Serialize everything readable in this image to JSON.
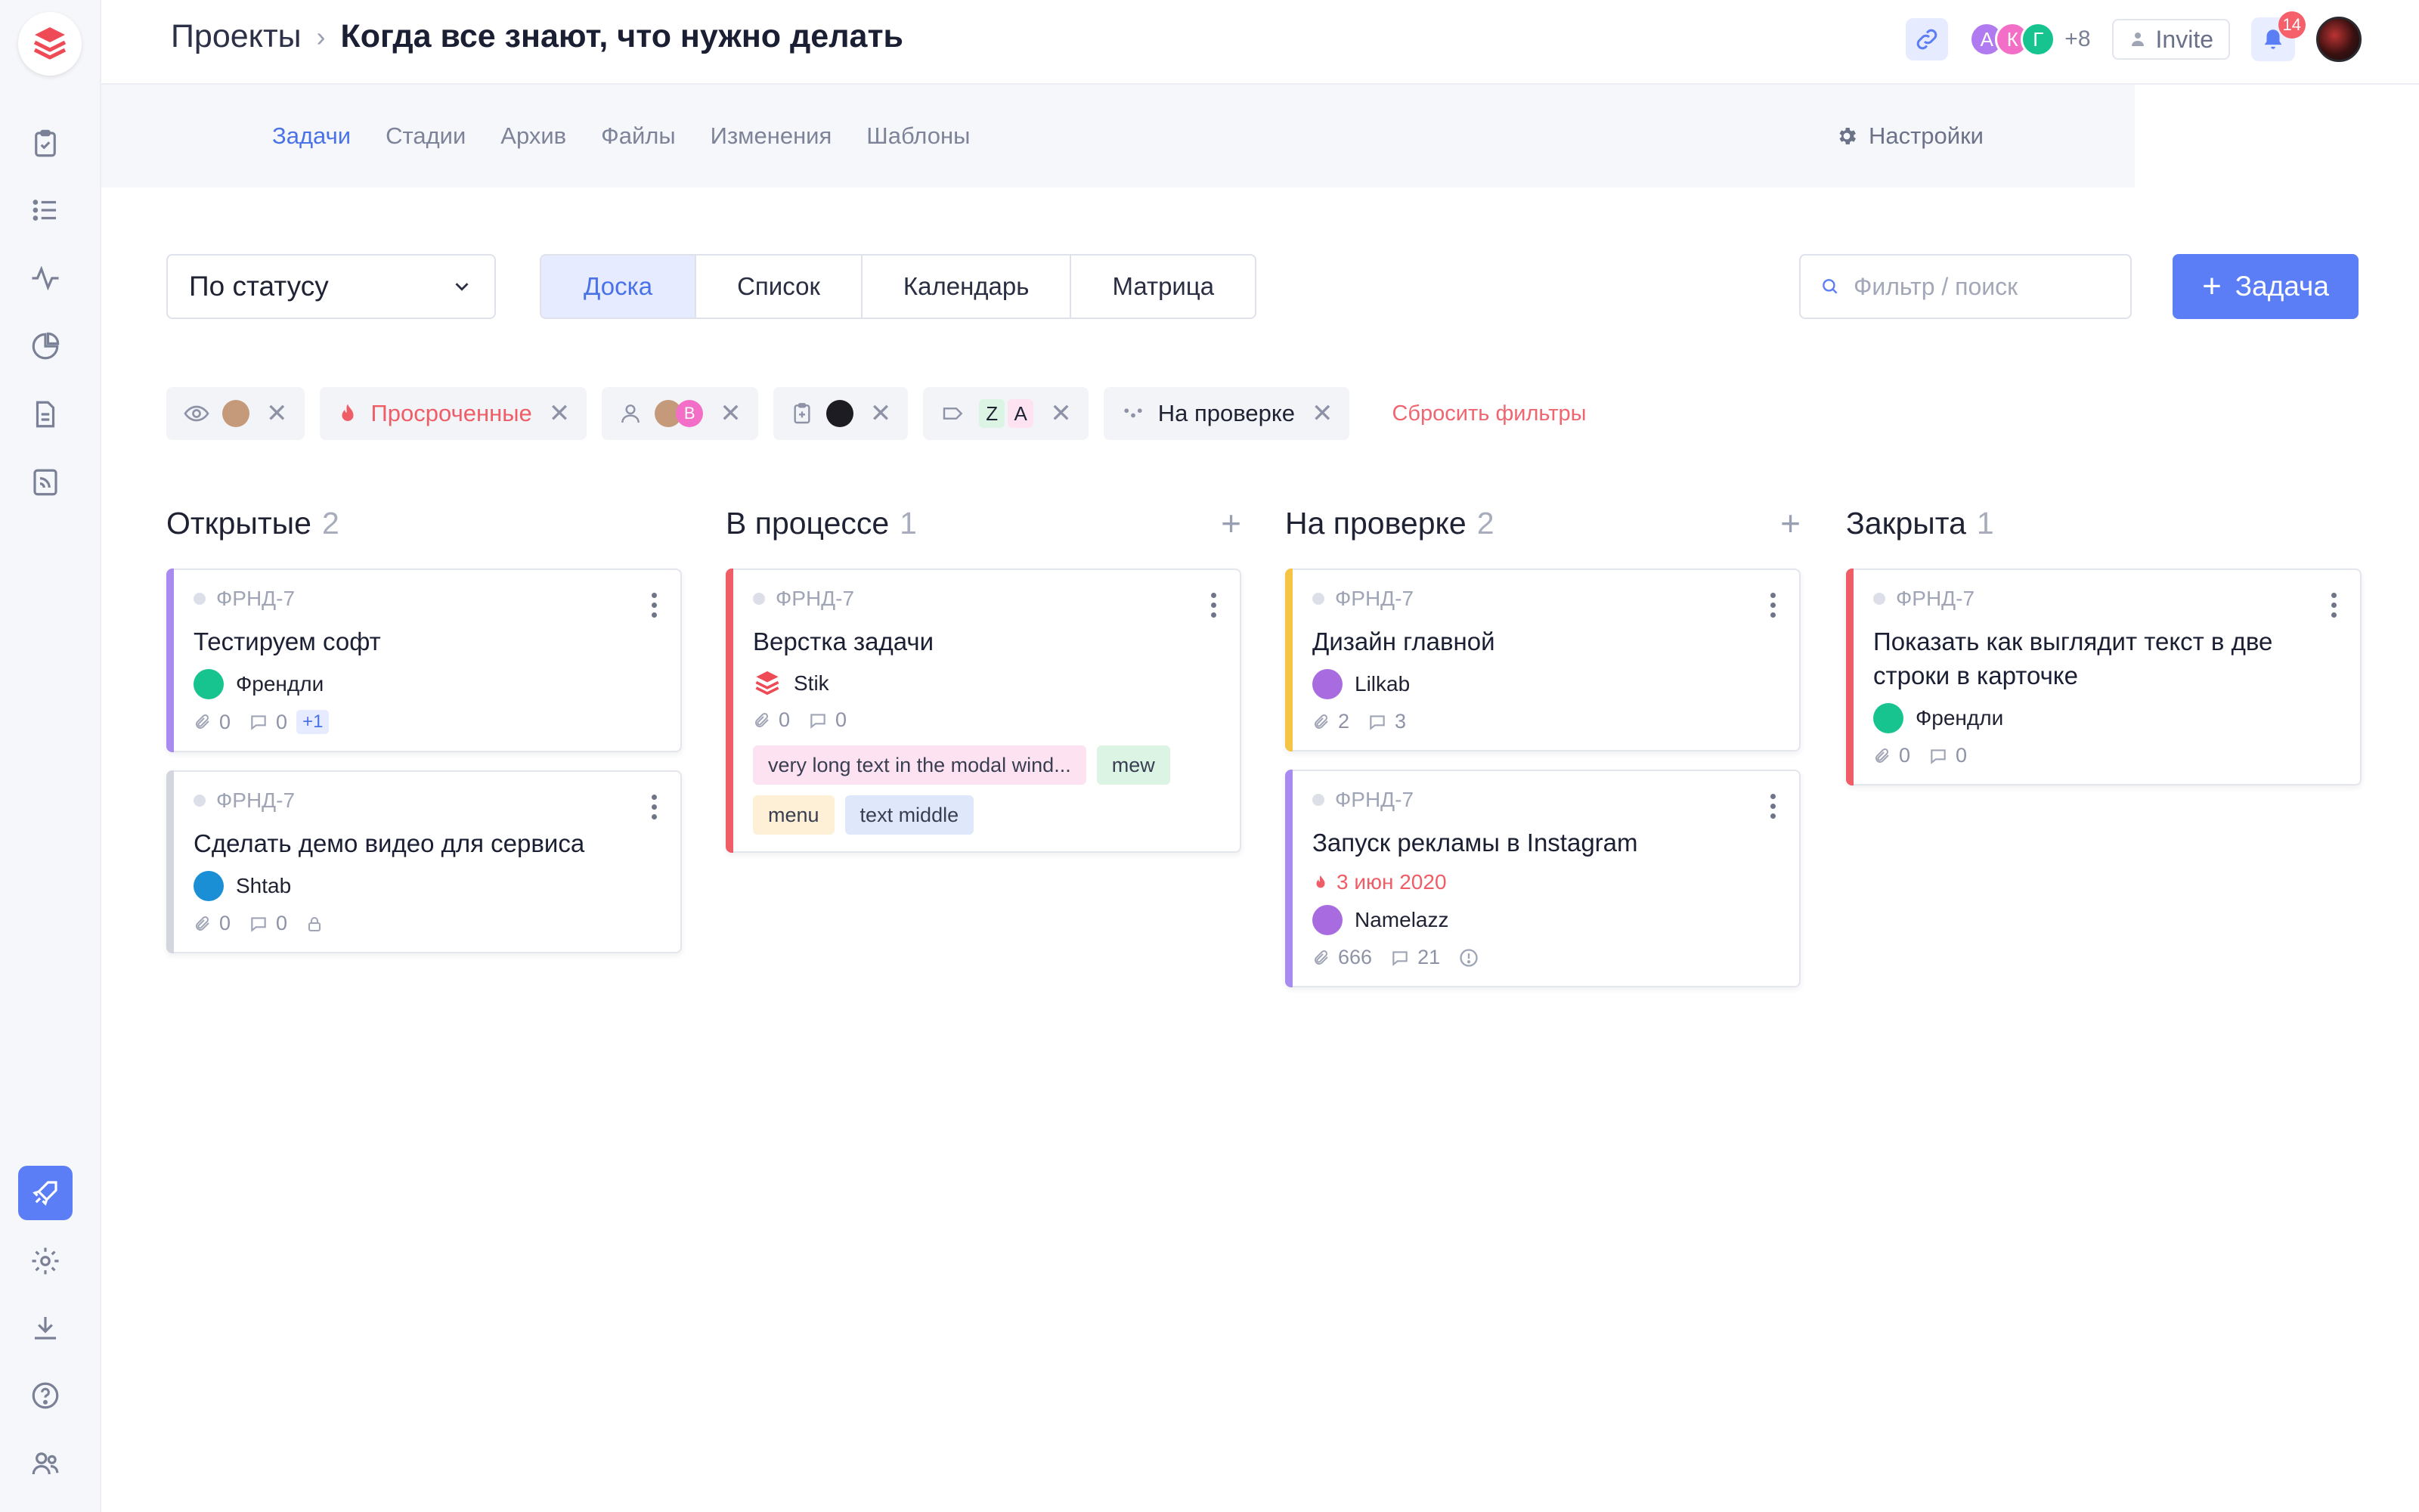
{
  "header": {
    "breadcrumb_root": "Проекты",
    "title": "Когда все знают, что нужно делать",
    "members": [
      {
        "initial": "А",
        "color": "#b07af0"
      },
      {
        "initial": "К",
        "color": "#f36fc7"
      },
      {
        "initial": "Г",
        "color": "#17c48f"
      }
    ],
    "members_more": "+8",
    "invite_label": "Invite",
    "notifications_count": "14"
  },
  "tabs": [
    {
      "label": "Задачи",
      "active": true
    },
    {
      "label": "Стадии"
    },
    {
      "label": "Архив"
    },
    {
      "label": "Файлы"
    },
    {
      "label": "Изменения"
    },
    {
      "label": "Шаблоны"
    }
  ],
  "settings_label": "Настройки",
  "toolbar": {
    "group_by": "По статусу",
    "views": [
      "Доска",
      "Список",
      "Календарь",
      "Матрица"
    ],
    "active_view": "Доска",
    "search_placeholder": "Фильтр / поиск",
    "add_label": "Задача"
  },
  "filters": {
    "overdue_label": "Просроченные",
    "assignee_letter": "В",
    "tag_letters": [
      "Z",
      "A"
    ],
    "status_label": "На проверке",
    "reset_label": "Сбросить фильтры"
  },
  "columns": [
    {
      "title": "Открытые",
      "count": "2",
      "addable": false,
      "cards": [
        {
          "code": "ФРНД-7",
          "name": "Тестируем софт",
          "stripe": "#a78bf0",
          "assignee": "Френдли",
          "assignee_color": "#17c48f",
          "attachments": "0",
          "comments": "0",
          "extra": "+1"
        },
        {
          "code": "ФРНД-7",
          "name": "Сделать демо видео для сервиса",
          "stripe": "#d4d6de",
          "assignee": "Shtab",
          "assignee_color": "#1a8fd6",
          "attachments": "0",
          "comments": "0",
          "locked": true
        }
      ]
    },
    {
      "title": "В процессе",
      "count": "1",
      "addable": true,
      "cards": [
        {
          "code": "ФРНД-7",
          "name": "Верстка задачи",
          "stripe": "#ef5d67",
          "assignee": "Stik",
          "assignee_logo": true,
          "attachments": "0",
          "comments": "0",
          "tags": [
            {
              "label": "very long text in the modal wind...",
              "color": "#fde3f2"
            },
            {
              "label": "mew",
              "color": "#dcf4e3"
            },
            {
              "label": "menu",
              "color": "#fdf0d6"
            },
            {
              "label": "text middle",
              "color": "#dfe8fb"
            }
          ]
        }
      ]
    },
    {
      "title": "На проверке",
      "count": "2",
      "addable": true,
      "cards": [
        {
          "code": "ФРНД-7",
          "name": "Дизайн главной",
          "stripe": "#f6c445",
          "assignee": "Lilkab",
          "assignee_color": "#a86be0",
          "attachments": "2",
          "comments": "3"
        },
        {
          "code": "ФРНД-7",
          "name": "Запуск рекламы в Instagram",
          "stripe": "#a78bf0",
          "due": "3 июн 2020",
          "assignee": "Namelazz",
          "assignee_color": "#a86be0",
          "attachments": "666",
          "comments": "21",
          "info": true
        }
      ]
    },
    {
      "title": "Закрыта",
      "count": "1",
      "addable": false,
      "cards": [
        {
          "code": "ФРНД-7",
          "name": "Показать как выглядит текст в две строки в карточке",
          "stripe": "#ef5d67",
          "assignee": "Френдли",
          "assignee_color": "#17c48f",
          "attachments": "0",
          "comments": "0"
        }
      ]
    }
  ]
}
